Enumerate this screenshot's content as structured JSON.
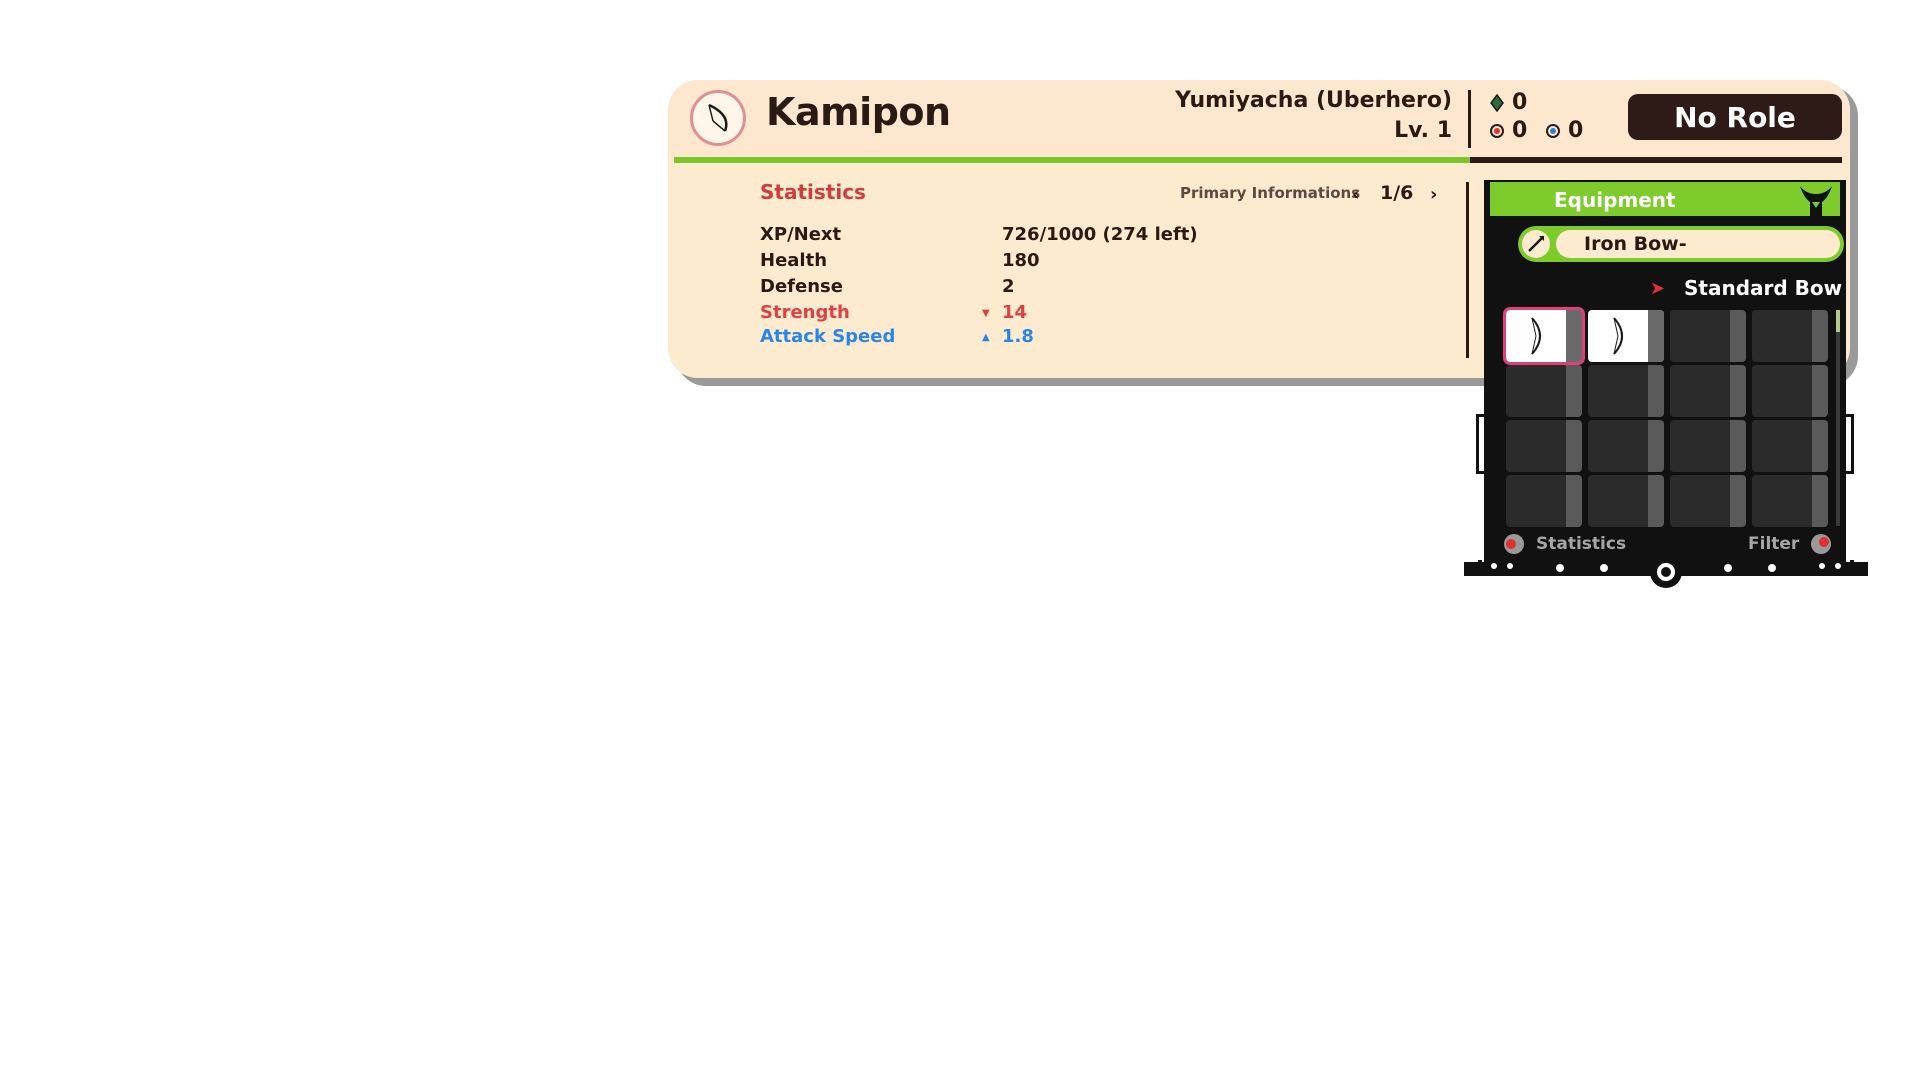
{
  "character": {
    "name": "Kamipon",
    "class_name": "Yumiyacha (Uberhero)",
    "level": "Lv. 1",
    "icon": "bow-icon"
  },
  "resources": {
    "green": "0",
    "red": "0",
    "blue": "0"
  },
  "role_button": "No Role",
  "stats_panel": {
    "title": "Statistics",
    "page_label": "Primary Informations",
    "page": "1/6",
    "rows": [
      {
        "label": "XP/Next",
        "value": "726/1000 (274 left)"
      },
      {
        "label": "Health",
        "value": "180"
      },
      {
        "label": "Defense",
        "value": "2"
      },
      {
        "label": "Strength",
        "value": "14",
        "trend": "down"
      },
      {
        "label": "Attack Speed",
        "value": "1.8",
        "trend": "up"
      }
    ]
  },
  "equipment": {
    "title": "Equipment",
    "weapon_name": "Iron Bow-",
    "weapon_type": "Standard Bow",
    "grid": {
      "rows": 4,
      "cols": 4,
      "filled_slots": [
        0,
        1
      ],
      "selected_slot": 0,
      "item_icon": "bow-icon"
    },
    "footer_left": "Statistics",
    "footer_right": "Filter"
  },
  "colors": {
    "card_bg": "#fdebd0",
    "accent_green": "#7ecb2c",
    "dark": "#2e1a17",
    "stat_down": "#e04040",
    "stat_up": "#2a86e6"
  }
}
